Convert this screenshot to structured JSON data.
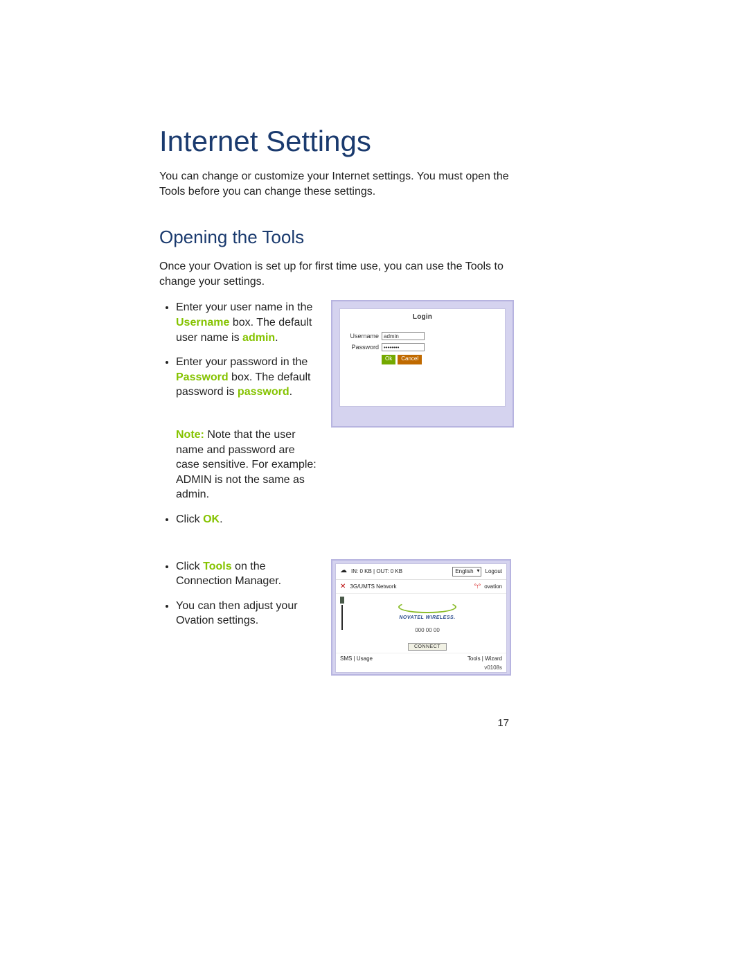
{
  "colors": {
    "heading": "#1a3a6e",
    "highlight": "#85c300"
  },
  "title": "Internet Settings",
  "intro": "You can change or customize your Internet settings. You must open the Tools before you can change these settings.",
  "section_title": "Opening the Tools",
  "section_intro": "Once your Ovation is set up for first time use, you can use the Tools to change your settings.",
  "bullets1": {
    "username": {
      "pre": "Enter your user name in the ",
      "box_word": "Username",
      "mid": " box. The default user name is ",
      "value": "admin",
      "post": "."
    },
    "password": {
      "pre": "Enter your password in the ",
      "box_word": "Password",
      "mid": " box. The default password is ",
      "value": "password",
      "post": "."
    }
  },
  "note": {
    "label": "Note:",
    "text": " Note that the user name and password are case sensitive. For example: ADMIN is not the same as admin."
  },
  "bullets_ok": {
    "pre": "Click ",
    "word": "OK",
    "post": "."
  },
  "bullets2": {
    "tools": {
      "pre": "Click ",
      "word": "Tools",
      "post": " on the Connection Manager."
    },
    "adjust": "You can then adjust your Ovation settings."
  },
  "login_shot": {
    "heading": "Login",
    "username_label": "Username",
    "username_value": "admin",
    "password_label": "Password",
    "password_value": "••••••••",
    "ok": "Ok",
    "cancel": "Cancel"
  },
  "cm_shot": {
    "io": "IN: 0 KB | OUT: 0 KB",
    "lang": "English",
    "logout": "Logout",
    "network": "3G/UMTS Network",
    "device": "ovation",
    "brand": "NOVATEL WIRELESS.",
    "timer": "000 00 00",
    "connect": "CONNECT",
    "bottom_left": "SMS | Usage",
    "bottom_right": "Tools | Wizard",
    "version": "v0108s"
  },
  "page_number": "17"
}
